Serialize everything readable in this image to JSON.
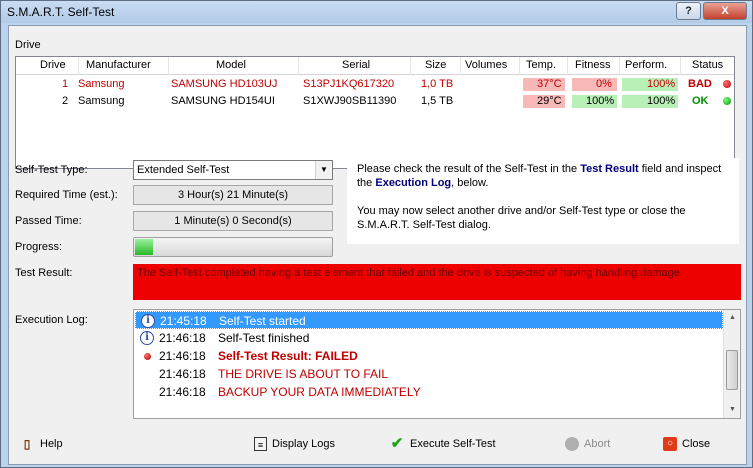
{
  "window": {
    "title": "S.M.A.R.T. Self-Test",
    "help_label": "?",
    "close_label": "X"
  },
  "drive_section": {
    "label": "Drive",
    "columns": [
      "Drive",
      "Manufacturer",
      "Model",
      "Serial",
      "Size",
      "Volumes",
      "Temp.",
      "Fitness",
      "Perform.",
      "Status"
    ],
    "rows": [
      {
        "drive": "1",
        "manufacturer": "Samsung",
        "model": "SAMSUNG HD103UJ",
        "serial": "S13PJ1KQ617320",
        "size": "1,0 TB",
        "volumes": "",
        "temp": "37°C",
        "fitness": "0%",
        "performance": "100%",
        "status": "BAD",
        "status_color": "#c00000",
        "highlight": true
      },
      {
        "drive": "2",
        "manufacturer": "Samsung",
        "model": "SAMSUNG HD154UI",
        "serial": "S1XWJ90SB11390",
        "size": "1,5 TB",
        "volumes": "",
        "temp": "29°C",
        "fitness": "100%",
        "performance": "100%",
        "status": "OK",
        "status_color": "#009000",
        "highlight": false
      }
    ]
  },
  "form": {
    "type_label": "Self-Test Type:",
    "type_value": "Extended Self-Test",
    "required_label": "Required Time (est.):",
    "required_value": "3 Hour(s) 21 Minute(s)",
    "passed_label": "Passed Time:",
    "passed_value": "1 Minute(s) 0 Second(s)",
    "progress_label": "Progress:",
    "progress_value": 0.09,
    "result_label": "Test Result:",
    "result_text": "The Self-Test completed having a test element that failed and the drive is suspected of having handling damage.",
    "log_label": "Execution Log:"
  },
  "info": {
    "p1_a": "Please check the result of the Self-Test in the ",
    "p1_b": "Test Result",
    "p1_c": " field and inspect the ",
    "p1_d": "Execution Log",
    "p1_e": ", below.",
    "p2": "You may now select another drive and/or Self-Test type or close the S.M.A.R.T. Self-Test dialog."
  },
  "log": [
    {
      "icon": "info-icon",
      "time": "21:45:18",
      "message": "Self-Test started",
      "style": "selected"
    },
    {
      "icon": "info-icon",
      "time": "21:46:18",
      "message": "Self-Test finished",
      "style": "normal"
    },
    {
      "icon": "red-dot-icon",
      "time": "21:46:18",
      "message": "Self-Test Result: FAILED",
      "style": "error-bold"
    },
    {
      "icon": "",
      "time": "21:46:18",
      "message": "THE DRIVE IS ABOUT TO FAIL",
      "style": "error"
    },
    {
      "icon": "",
      "time": "21:46:18",
      "message": "BACKUP YOUR DATA IMMEDIATELY",
      "style": "error"
    }
  ],
  "buttons": {
    "help": "Help",
    "display_logs": "Display Logs",
    "execute": "Execute Self-Test",
    "abort": "Abort",
    "close": "Close"
  },
  "colors": {
    "title_bg": "#b9d1ea",
    "bad_bar": "#f7b8b8",
    "good_bar": "#b8f0b8",
    "result_bg": "#ee0000",
    "selected_row": "#3399ff"
  }
}
